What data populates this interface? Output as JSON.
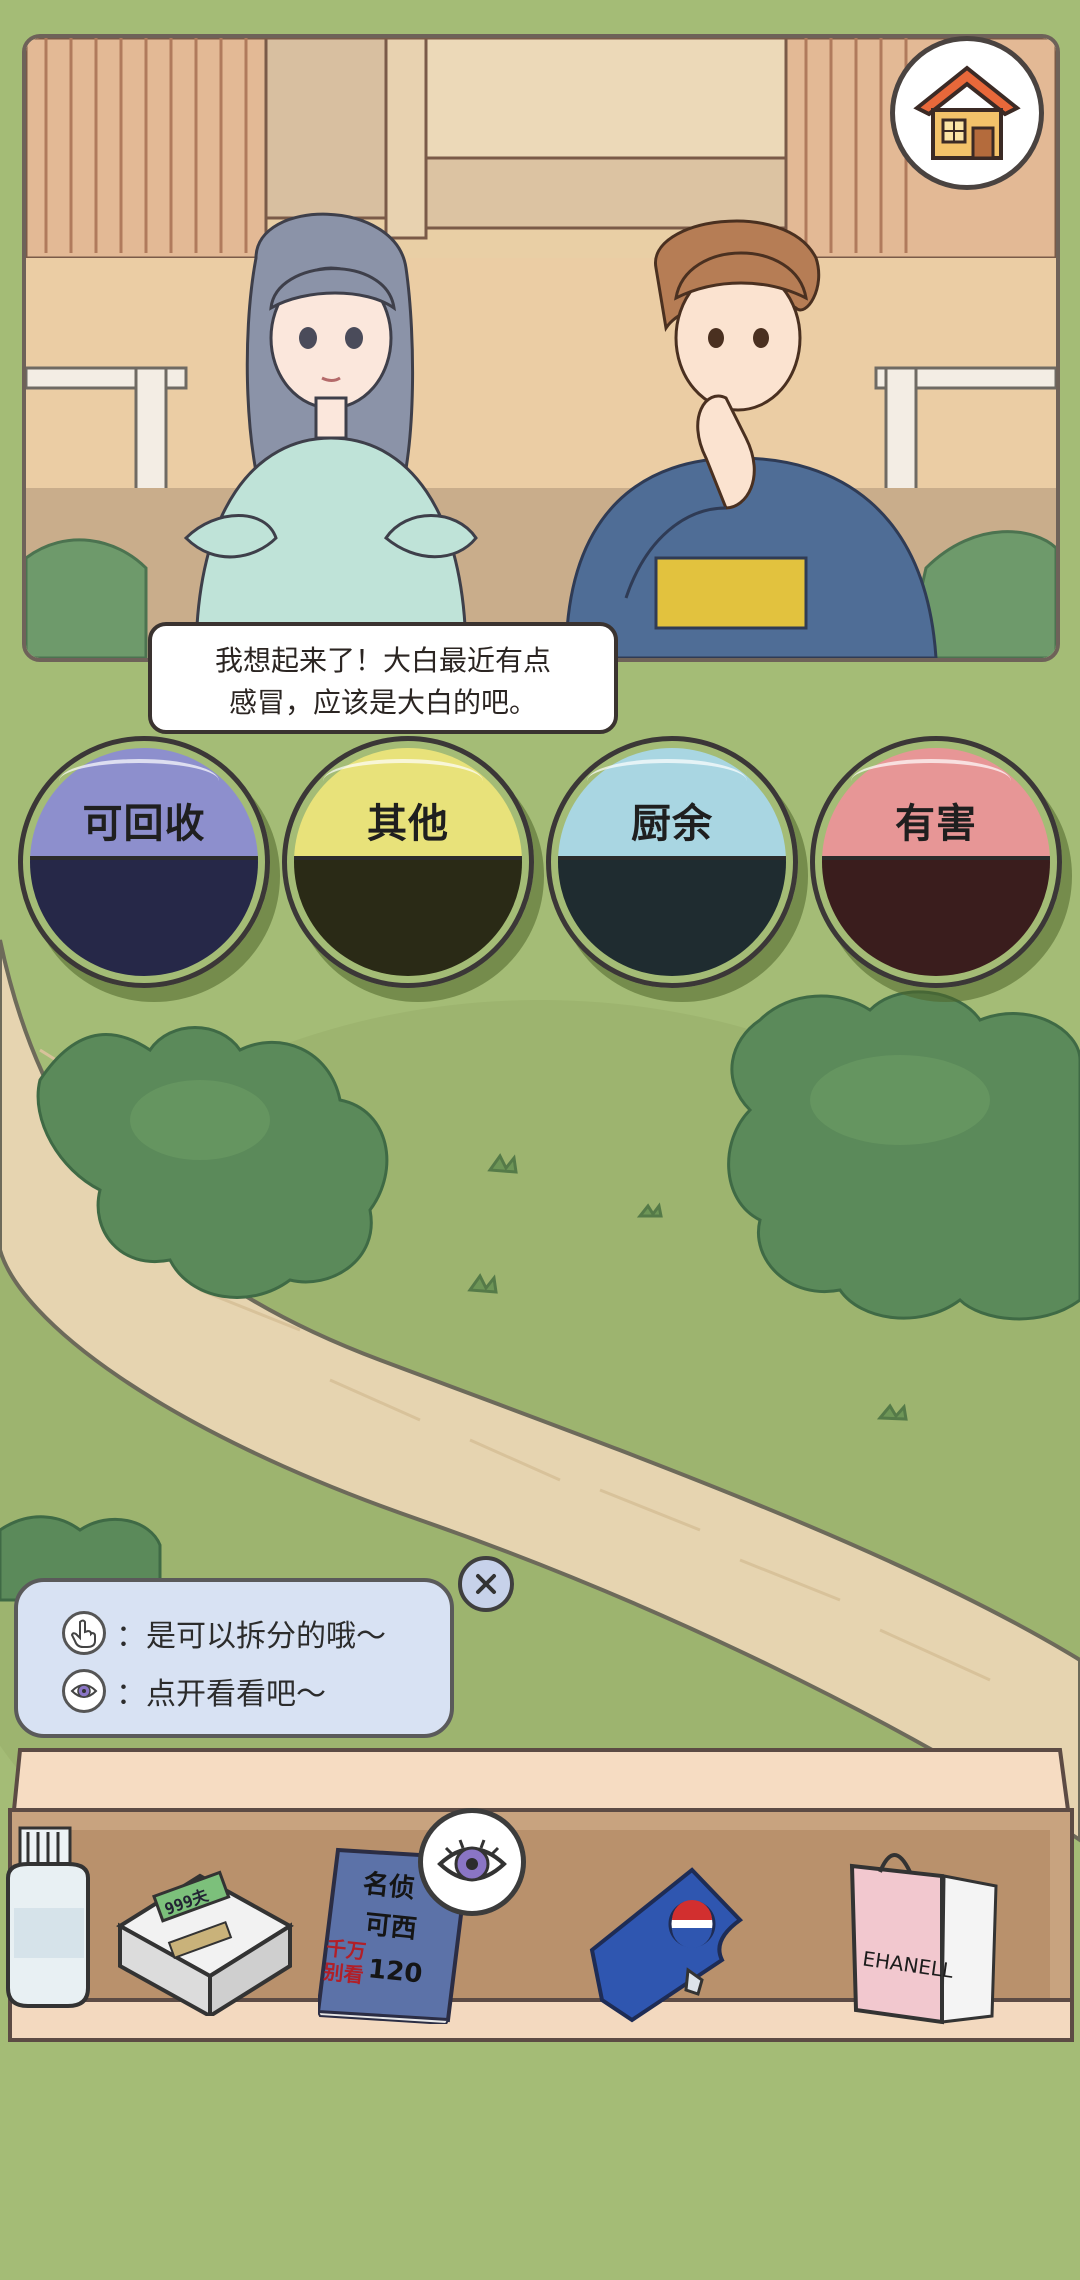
{
  "home": {
    "label": "home"
  },
  "dialogue": {
    "line1": "我想起来了！大白最近有点",
    "line2": "感冒，应该是大白的吧。"
  },
  "bins": [
    {
      "label": "可回收",
      "top_color": "#8d8fcd",
      "bottom_color": "#262848",
      "border": "#6c6fb4"
    },
    {
      "label": "其他",
      "top_color": "#e8e27a",
      "bottom_color": "#2a2a16",
      "border": "#c9c35a"
    },
    {
      "label": "厨余",
      "top_color": "#a9d6e2",
      "bottom_color": "#1f2c30",
      "border": "#88bccb"
    },
    {
      "label": "有害",
      "top_color": "#e79696",
      "bottom_color": "#3a1d1d",
      "border": "#c97171"
    }
  ],
  "hint": {
    "line1": "：是可以拆分的哦～",
    "line2": "：点开看看吧～",
    "icon1": "pointer-hand-icon",
    "icon2": "eye-icon"
  },
  "shelf": {
    "book_text": [
      "名侦",
      "可西",
      "千万",
      "别看",
      "120"
    ],
    "pager_text": "999夫",
    "bag_text": "EHANELL"
  },
  "colors": {
    "background": "#a4bc76",
    "path": "#e6d4b0",
    "tree": "#5b8a5a"
  }
}
